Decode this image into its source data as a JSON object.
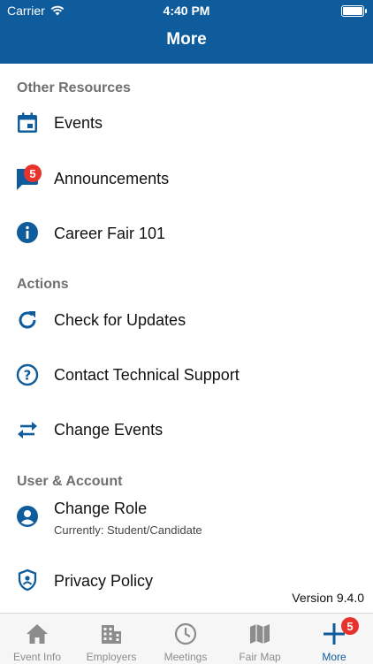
{
  "status_bar": {
    "carrier": "Carrier",
    "time": "4:40 PM"
  },
  "nav": {
    "title": "More"
  },
  "sections": {
    "other_resources": {
      "header": "Other Resources",
      "events": "Events",
      "announcements": "Announcements",
      "announcements_badge": "5",
      "career_fair": "Career Fair 101"
    },
    "actions": {
      "header": "Actions",
      "check_updates": "Check for Updates",
      "contact_support": "Contact Technical Support",
      "change_events": "Change Events"
    },
    "user_account": {
      "header": "User & Account",
      "change_role": "Change Role",
      "current_role": "Currently: Student/Candidate",
      "privacy_policy": "Privacy Policy"
    }
  },
  "version": "Version 9.4.0",
  "tabs": {
    "event_info": "Event Info",
    "employers": "Employers",
    "meetings": "Meetings",
    "fair_map": "Fair Map",
    "more": "More",
    "more_badge": "5"
  },
  "colors": {
    "brand": "#0f5c9d",
    "badge": "#e8332d",
    "section_header": "#6f6f6f",
    "tab_inactive": "#8c8c8c"
  }
}
